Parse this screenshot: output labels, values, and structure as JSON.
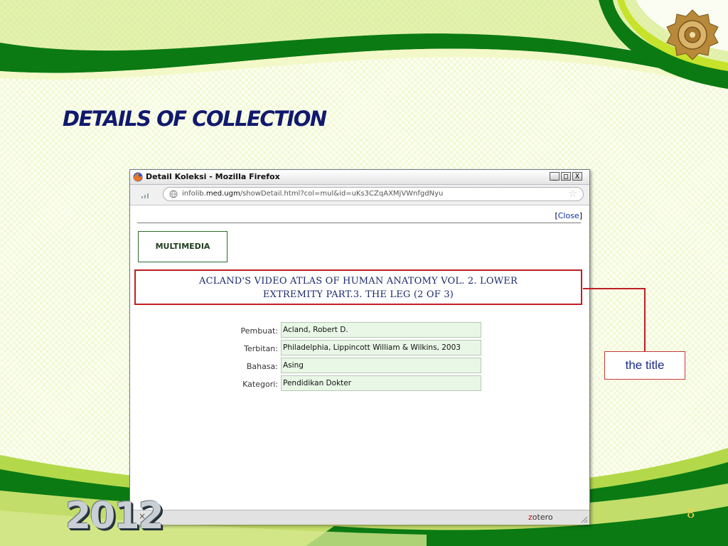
{
  "slide": {
    "title": "DETAILS OF COLLECTION",
    "year": "2012",
    "page_number": "8",
    "callout": "the title"
  },
  "browser": {
    "window_title": "Detail Koleksi - Mozilla Firefox",
    "buttons": {
      "minimize": "_",
      "maximize": "□",
      "close": "X"
    },
    "url_prefix": "infolib.",
    "url_host": "med.ugm",
    "url_rest": "/showDetail.html?col=mul&id=uKs3CZqAXMjVWnfgdNyu",
    "close_link": {
      "open": "[",
      "label": "Close",
      "end": "]"
    },
    "category_tab": "MULTIMEDIA",
    "book_title_line1": "ACLAND'S VIDEO ATLAS OF HUMAN ANATOMY VOL. 2. LOWER",
    "book_title_line2": "EXTREMITY PART.3. THE LEG (2 OF 3)",
    "fields": [
      {
        "label": "Pembuat:",
        "value": "Acland, Robert D."
      },
      {
        "label": "Terbitan:",
        "value": "Philadelphia, Lippincott William & Wilkins, 2003"
      },
      {
        "label": "Bahasa:",
        "value": "Asing"
      },
      {
        "label": "Kategori:",
        "value": "Pendidikan Dokter"
      }
    ],
    "status_close": "×",
    "status_zotero": "zotero"
  },
  "colors": {
    "green_dark": "#0b7a13",
    "green_light": "#b9e02b",
    "title_blue": "#11196e",
    "highlight_red": "#c11e24"
  }
}
